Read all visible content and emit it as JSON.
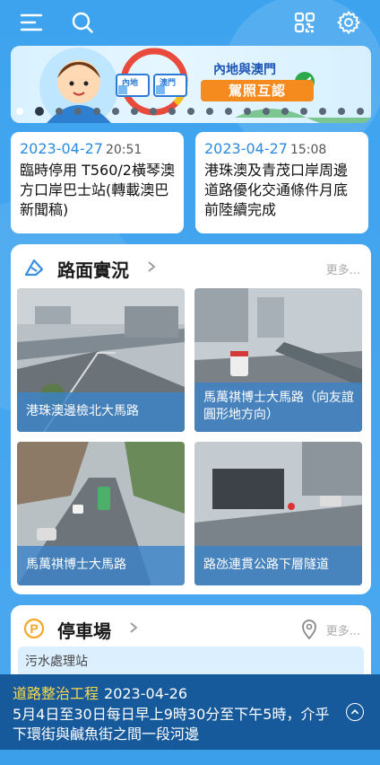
{
  "banner": {
    "title": "內地與澳門",
    "subtitle": "駕照互認",
    "tag_left": "內地",
    "tag_right": "澳門"
  },
  "carousel": {
    "total": 19,
    "active": 1
  },
  "news": [
    {
      "date": "2023-04-27",
      "time": "20:51",
      "text": "臨時停用 T560/2橫琴澳方口岸巴士站(轉載澳巴新聞稿)"
    },
    {
      "date": "2023-04-27",
      "time": "15:08",
      "text": "港珠澳及青茂口岸周邊道路優化交通條件月底前陸續完成"
    }
  ],
  "road_section": {
    "title": "路面實況",
    "more": "更多...",
    "cameras": [
      {
        "label": "港珠澳邊檢北大馬路"
      },
      {
        "label": "馬萬祺博士大馬路（向友誼圓形地方向）"
      },
      {
        "label": "馬萬祺博士大馬路"
      },
      {
        "label": "路氹連貫公路下層隧道"
      }
    ]
  },
  "parking_section": {
    "title": "停車場",
    "more": "更多...",
    "first_item": "污水處理站"
  },
  "ticker": {
    "category": "道路整治工程",
    "date": "2023-04-26",
    "text": "5月4日至30日每日早上9時30分至下午5時，介乎下環街與鹹魚街之間一段河邊"
  },
  "colors": {
    "background": "#3ea0ea",
    "accent": "#2b8be0",
    "ticker_bg": "#175a9c",
    "ticker_category": "#ffd84a"
  }
}
